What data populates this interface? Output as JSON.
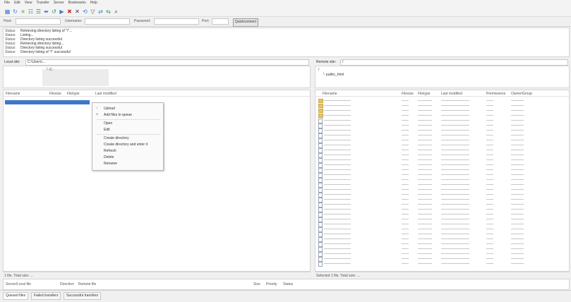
{
  "menu": [
    "File",
    "Edit",
    "View",
    "Transfer",
    "Server",
    "Bookmarks",
    "Help"
  ],
  "toolbar_icons": [
    "site-manager-icon",
    "refresh-icon",
    "log-toggle-icon",
    "tree-toggle-icon",
    "remote-tree-icon",
    "queue-toggle-icon",
    "reload-icon",
    "process-queue-icon",
    "cancel-icon",
    "disconnect-icon",
    "reconnect-icon",
    "filter-icon",
    "compare-icon",
    "sync-browse-icon",
    "search-icon"
  ],
  "quickconnect": {
    "host_label": "Host:",
    "host_value": "",
    "user_label": "Username:",
    "user_value": "",
    "pass_label": "Password:",
    "pass_value": "",
    "port_label": "Port:",
    "port_value": "",
    "button": "Quickconnect"
  },
  "log": [
    {
      "k": "Status:",
      "t": "Retrieving directory listing of \"/\"..."
    },
    {
      "k": "Status:",
      "t": "Listing..."
    },
    {
      "k": "Status:",
      "t": "Directory listing successful"
    },
    {
      "k": "Status:",
      "t": "Retrieving directory listing..."
    },
    {
      "k": "Status:",
      "t": "Directory listing successful"
    },
    {
      "k": "Status:",
      "t": "Directory listing of \"/\" successful"
    }
  ],
  "local": {
    "site_label": "Local site:",
    "site_value": "C:\\Users\\...",
    "tree": [
      "└ C:"
    ],
    "headers": [
      "Filename",
      "Filesize",
      "Filetype",
      "Last modified"
    ],
    "status": "1 file. Total size: ..."
  },
  "remote": {
    "site_label": "Remote site:",
    "site_value": "/",
    "tree": [
      "/",
      "└ public_html"
    ],
    "headers": [
      "Filename",
      "Filesize",
      "Filetype",
      "Last modified",
      "Permissions",
      "Owner/Group"
    ],
    "status": "Selected 1 file. Total size: ..."
  },
  "context_menu": [
    {
      "label": "Upload",
      "icon": "upload-icon",
      "glyph": "↑"
    },
    {
      "label": "Add files to queue",
      "icon": "add-to-queue-icon",
      "glyph": "+"
    },
    {
      "label": "Open",
      "icon": "",
      "glyph": ""
    },
    {
      "label": "Edit",
      "icon": "",
      "glyph": ""
    },
    {
      "label": "Create directory",
      "icon": "",
      "glyph": ""
    },
    {
      "label": "Create directory and enter it",
      "icon": "",
      "glyph": ""
    },
    {
      "label": "Refresh",
      "icon": "",
      "glyph": ""
    },
    {
      "label": "Delete",
      "icon": "",
      "glyph": ""
    },
    {
      "label": "Rename",
      "icon": "",
      "glyph": ""
    }
  ],
  "queue": {
    "server_label": "Server/Local file",
    "direction_label": "Direction",
    "remote_label": "Remote file",
    "size_label": "Size",
    "priority_label": "Priority",
    "status_label": "Status"
  },
  "tabs": [
    "Queued files",
    "Failed transfers",
    "Successful transfers"
  ]
}
